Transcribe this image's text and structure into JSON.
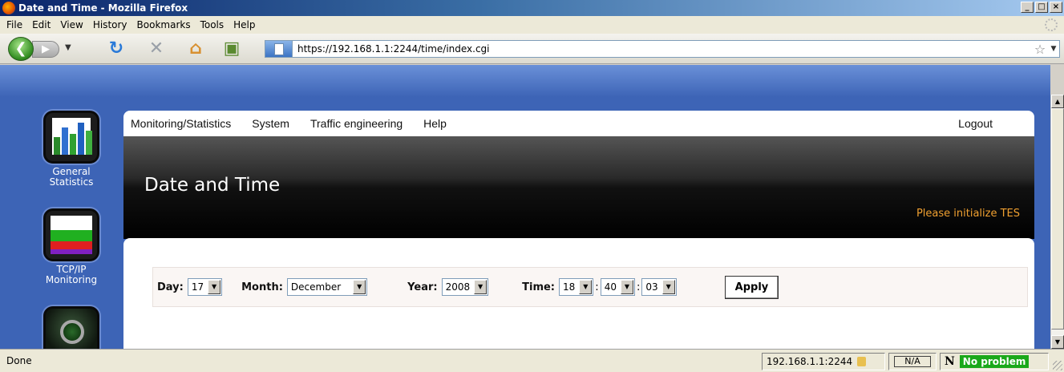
{
  "window": {
    "title": "Date and Time - Mozilla Firefox",
    "controls": [
      "_",
      "□",
      "×"
    ]
  },
  "menubar": {
    "items": [
      "File",
      "Edit",
      "View",
      "History",
      "Bookmarks",
      "Tools",
      "Help"
    ]
  },
  "toolbar": {
    "back_icon": "back-arrow-icon",
    "forward_icon": "forward-arrow-icon",
    "url": "https://192.168.1.1:2244/time/index.cgi"
  },
  "sidebar": {
    "items": [
      {
        "label_line1": "General",
        "label_line2": "Statistics",
        "icon": "statistics-chart-icon"
      },
      {
        "label_line1": "TCP/IP",
        "label_line2": "Monitoring",
        "icon": "tcp-monitoring-graph-icon"
      },
      {
        "icon": "magnifier-icon"
      }
    ]
  },
  "topnav": {
    "items": [
      "Monitoring/Statistics",
      "System",
      "Traffic engineering",
      "Help"
    ],
    "logout": "Logout"
  },
  "header": {
    "title": "Date and Time",
    "warning": "Please initialize TES",
    "warning_color": "#f0a030"
  },
  "form": {
    "day_label": "Day:",
    "day_value": "17",
    "month_label": "Month:",
    "month_value": "December",
    "year_label": "Year:",
    "year_value": "2008",
    "time_label": "Time:",
    "hour": "18",
    "minute": "40",
    "second": "03",
    "time_separator": ":",
    "apply_label": "Apply"
  },
  "statusbar": {
    "status": "Done",
    "host": "192.168.1.1:2244",
    "na": "N/A",
    "n_label": "N",
    "state": "No problem",
    "state_color": "#1aa81a"
  }
}
